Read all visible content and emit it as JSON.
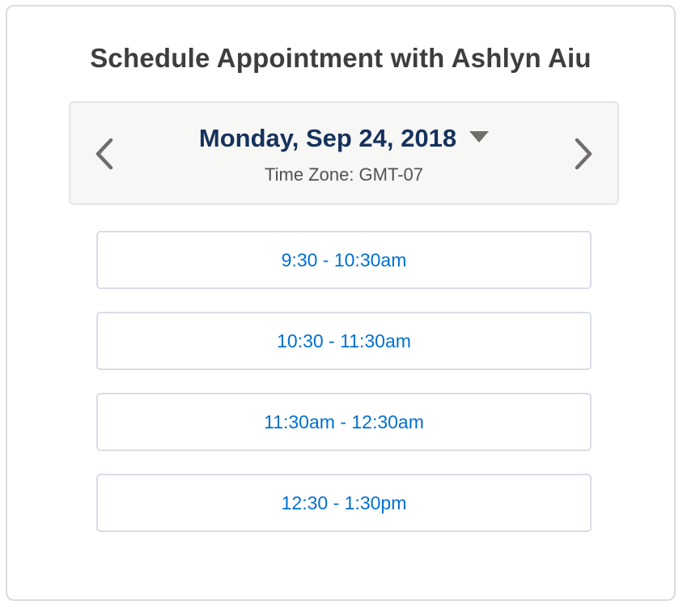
{
  "title": "Schedule Appointment with Ashlyn Aiu",
  "date_header": {
    "date": "Monday, Sep 24, 2018",
    "timezone": "Time Zone: GMT-07",
    "prev_icon": "chevron-left-icon",
    "next_icon": "chevron-right-icon",
    "dropdown_icon": "caret-down-icon"
  },
  "slots": [
    {
      "label": "9:30 - 10:30am"
    },
    {
      "label": "10:30 - 11:30am"
    },
    {
      "label": "11:30am - 12:30am"
    },
    {
      "label": "12:30 - 1:30pm"
    }
  ],
  "colors": {
    "link": "#0070d2",
    "date_text": "#16325c",
    "title_text": "#3e3e3c",
    "header_bg": "#f7f7f6",
    "icon": "#706e6b"
  }
}
